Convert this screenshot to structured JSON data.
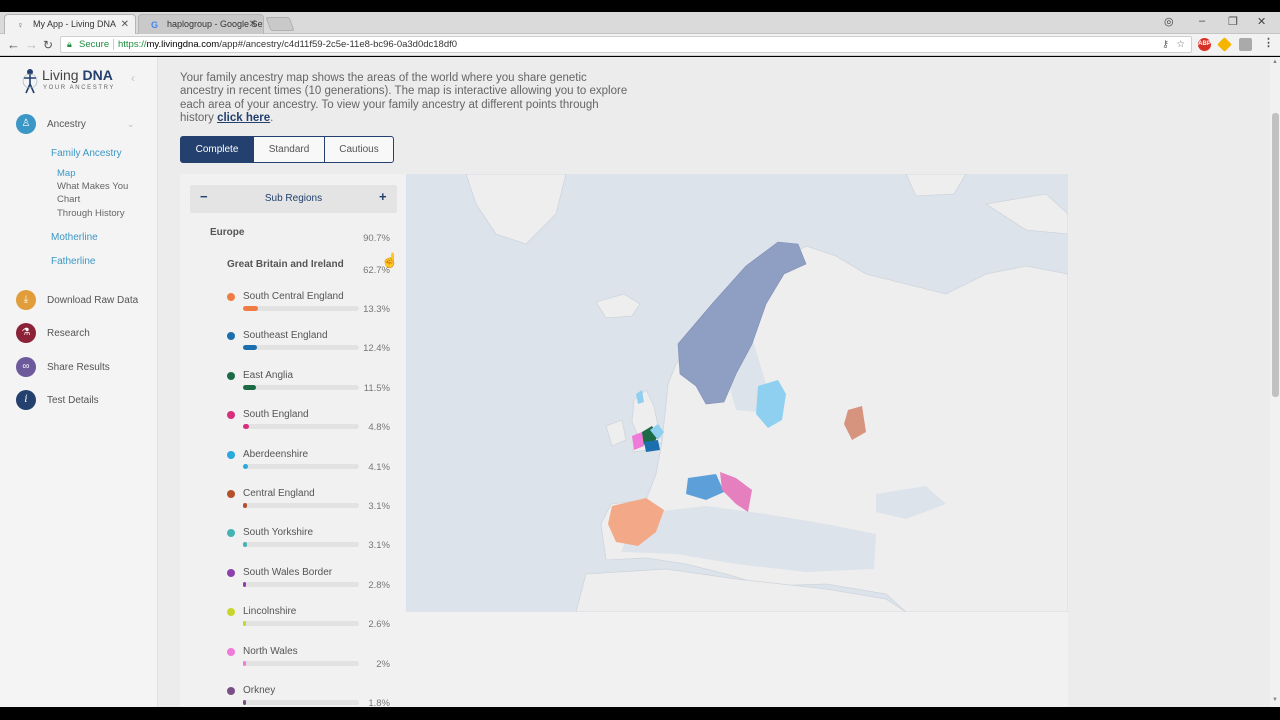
{
  "browser": {
    "tabs": [
      {
        "title": "My App - Living DNA",
        "active": true
      },
      {
        "title": "haplogroup - Google Se",
        "active": false
      }
    ],
    "secure_label": "Secure",
    "url_scheme": "https://",
    "url_host": "my.livingdna.com",
    "url_path": "/app#/ancestry/c4d11f59-2c5e-11e8-bc96-0a3d0dc18df0"
  },
  "sidebar": {
    "logo_name_a": "Living ",
    "logo_name_b": "DNA",
    "logo_tagline": "YOUR ANCESTRY",
    "ancestry_label": "Ancestry",
    "family_ancestry": "Family Ancestry",
    "sub_items": [
      "Map",
      "What Makes You",
      "Chart",
      "Through History"
    ],
    "motherline": "Motherline",
    "fatherline": "Fatherline",
    "download": "Download Raw Data",
    "research": "Research",
    "share": "Share Results",
    "test_details": "Test Details"
  },
  "main": {
    "intro_text": "Your family ancestry map shows the areas of the world where you share genetic ancestry in recent times (10 generations). The map is interactive allowing you to explore each area of your ancestry. To view your family ancestry at different points through history ",
    "intro_link": "click here",
    "intro_end": ".",
    "tabs": [
      "Complete",
      "Standard",
      "Cautious"
    ],
    "active_tab": "Complete",
    "sub_regions_title": "Sub Regions",
    "europe": {
      "name": "Europe",
      "pct": "90.7%"
    },
    "gbi": {
      "name": "Great Britain and Ireland",
      "pct": "62.7%"
    },
    "regions": [
      {
        "name": "South Central England",
        "pct": "13.3%",
        "value": 13.3,
        "color": "#f07c45"
      },
      {
        "name": "Southeast England",
        "pct": "12.4%",
        "value": 12.4,
        "color": "#1c6fae"
      },
      {
        "name": "East Anglia",
        "pct": "11.5%",
        "value": 11.5,
        "color": "#1c6b45"
      },
      {
        "name": "South England",
        "pct": "4.8%",
        "value": 4.8,
        "color": "#d6307d"
      },
      {
        "name": "Aberdeenshire",
        "pct": "4.1%",
        "value": 4.1,
        "color": "#29a9dd"
      },
      {
        "name": "Central England",
        "pct": "3.1%",
        "value": 3.1,
        "color": "#b4512d"
      },
      {
        "name": "South Yorkshire",
        "pct": "3.1%",
        "value": 3.1,
        "color": "#46b3b3"
      },
      {
        "name": "South Wales Border",
        "pct": "2.8%",
        "value": 2.8,
        "color": "#8e3fae"
      },
      {
        "name": "Lincolnshire",
        "pct": "2.6%",
        "value": 2.6,
        "color": "#c8d62c"
      },
      {
        "name": "North Wales",
        "pct": "2%",
        "value": 2.0,
        "color": "#ef7ad8"
      },
      {
        "name": "Orkney",
        "pct": "1.8%",
        "value": 1.8,
        "color": "#7a4f86"
      }
    ]
  },
  "colors": {
    "brand": "#23406e",
    "accent": "#3b97c6",
    "map_sea": "#dde3ea",
    "map_land": "#eeeeee",
    "scandinavia": "#8f9fc4",
    "iberia": "#f3a987",
    "baltic": "#8fd0f0",
    "alps": "#5d9fd8",
    "balkans": "#e67fbe",
    "russia": "#d6937e"
  }
}
